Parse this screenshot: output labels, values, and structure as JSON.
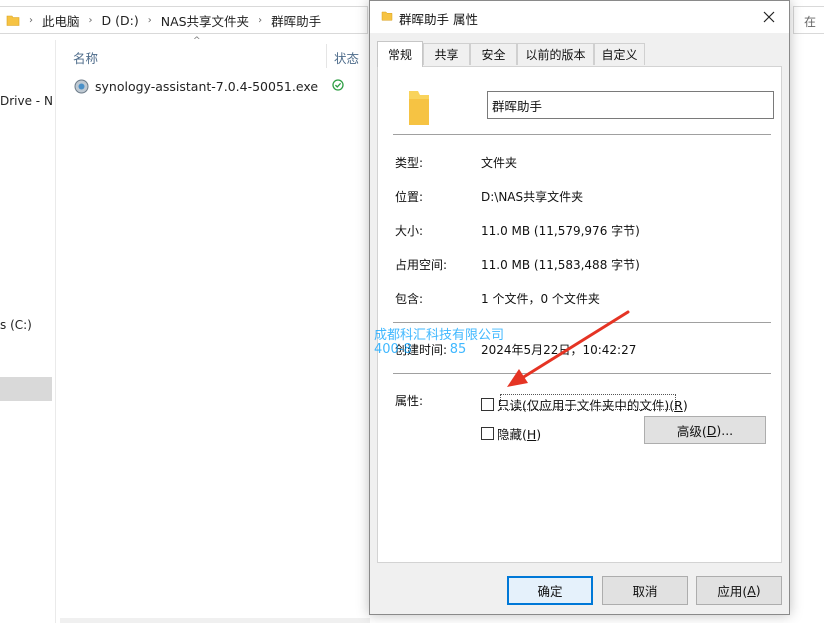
{
  "explorer": {
    "breadcrumbs": [
      "此电脑",
      "D (D:)",
      "NAS共享文件夹",
      "群晖助手"
    ],
    "search_stub": "在",
    "nav": [
      {
        "label": "Drive - N"
      },
      {
        "label": "s (C:)"
      }
    ],
    "columns": {
      "name": "名称",
      "status": "状态"
    },
    "file": {
      "name": "synology-assistant-7.0.4-50051.exe",
      "status_icon": "sync-ok-icon"
    }
  },
  "dialog": {
    "title": "群晖助手 属性",
    "tabs": [
      "常规",
      "共享",
      "安全",
      "以前的版本",
      "自定义"
    ],
    "active_tab": "常规",
    "folder_name": "群晖助手",
    "props": [
      {
        "label": "类型:",
        "value": "文件夹"
      },
      {
        "label": "位置:",
        "value": "D:\\NAS共享文件夹"
      },
      {
        "label": "大小:",
        "value": "11.0 MB (11,579,976 字节)"
      },
      {
        "label": "占用空间:",
        "value": "11.0 MB (11,583,488 字节)"
      },
      {
        "label": "包含:",
        "value": "1 个文件，0 个文件夹"
      }
    ],
    "created": {
      "label": "创建时间:",
      "value": "2024年5月22日，10:42:27"
    },
    "attributes": {
      "label": "属性:",
      "readonly": {
        "text": "只读(仅应用于文件夹中的文件)(",
        "key": "R",
        "suffix": ")",
        "checked": false
      },
      "hidden": {
        "text": "隐藏(",
        "key": "H",
        "suffix": ")",
        "checked": false
      },
      "advanced": {
        "text": "高级(",
        "key": "D",
        "suffix": ")..."
      }
    },
    "buttons": {
      "ok": "确定",
      "cancel": "取消",
      "apply_text": "应用(",
      "apply_key": "A",
      "apply_suffix": ")"
    }
  },
  "overlay": {
    "watermark_line1": "成都科汇科技有限公司",
    "watermark_line2": "400-8",
    "watermark_line2_tail": "85",
    "arrow_color": "#e53424"
  }
}
